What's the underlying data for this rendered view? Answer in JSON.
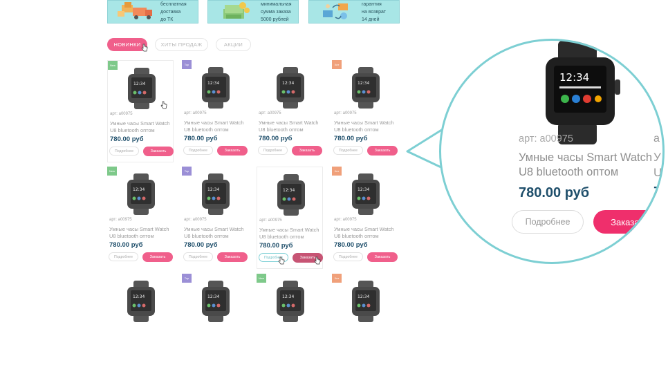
{
  "features": [
    {
      "icon": "truck-boxes-icon",
      "lines": [
        "бесплатная",
        "доставка",
        "до ТК"
      ]
    },
    {
      "icon": "money-icon",
      "lines": [
        "минимальная",
        "сумма заказа",
        "5000 рублей"
      ]
    },
    {
      "icon": "return-exchange-icon",
      "lines": [
        "гарантия",
        "на возврат",
        "14 дней"
      ]
    }
  ],
  "tabs": {
    "new_label": "НОВИНКИ",
    "hits_label": "ХИТЫ ПРОДАЖ",
    "sales_label": "АКЦИИ"
  },
  "colors": {
    "accent_pink": "#f05f8b",
    "order_pink": "#ef2f6c",
    "price_blue": "#1f4f6b",
    "ring_teal": "#7dcfd3",
    "badge_new": "#7ec98a",
    "badge_top": "#9b8fd6",
    "badge_hit": "#f0a07a"
  },
  "badges": {
    "new": "New",
    "top": "Top",
    "hit": "Хит"
  },
  "product": {
    "sku": "арт: a00975",
    "name_line1": "Умные часы Smart Watch",
    "name_line2": "U8 bluetooth оптом",
    "price": "780.00 руб",
    "more_label": "Подробнее",
    "order_label": "Заказать"
  },
  "zoom": {
    "sku": "арт: a00975",
    "name_line1": "Умные часы Smart Watch",
    "name_line2": "U8 bluetooth оптом",
    "price": "780.00 руб",
    "more_label": "Подробнее",
    "order_label": "Заказать",
    "next_card_sku_fragment": "a",
    "next_card_name_fragment_1": "У",
    "next_card_name_fragment_2": "U",
    "next_card_price_fragment": "7"
  }
}
